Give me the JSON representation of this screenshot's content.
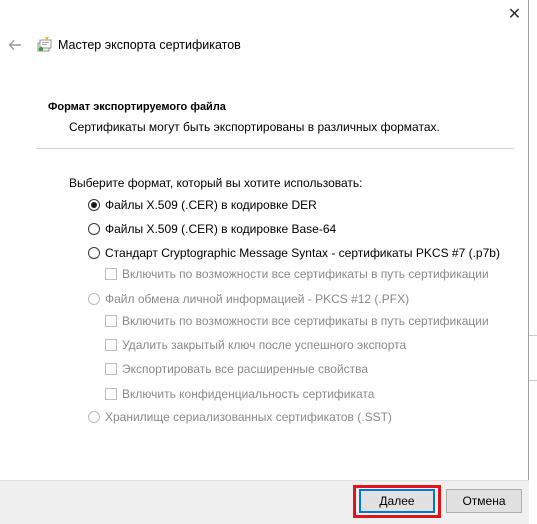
{
  "window": {
    "title": "Мастер экспорта сертификатов",
    "close_glyph": "✕"
  },
  "header": {
    "title": "Формат экспортируемого файла",
    "subtitle": "Сертификаты могут быть экспортированы в различных форматах."
  },
  "prompt": "Выберите формат, который вы хотите использовать:",
  "options": {
    "der": {
      "label": "Файлы X.509 (.CER) в кодировке DER",
      "checked": true,
      "enabled": true
    },
    "base64": {
      "label": "Файлы X.509 (.CER) в кодировке Base-64",
      "checked": false,
      "enabled": true
    },
    "pkcs7": {
      "label": "Стандарт Cryptographic Message Syntax - сертификаты PKCS #7 (.p7b)",
      "checked": false,
      "enabled": true
    },
    "pkcs7_include_chain": {
      "label": "Включить по возможности все сертификаты в путь сертификации",
      "checked": false,
      "enabled": false
    },
    "pfx": {
      "label": "Файл обмена личной информацией - PKCS #12 (.PFX)",
      "checked": false,
      "enabled": false
    },
    "pfx_include_chain": {
      "label": "Включить по возможности все сертификаты в путь сертификации",
      "checked": false,
      "enabled": false
    },
    "pfx_delete_key": {
      "label": "Удалить закрытый ключ после успешного экспорта",
      "checked": false,
      "enabled": false
    },
    "pfx_export_props": {
      "label": "Экспортировать все расширенные свойства",
      "checked": false,
      "enabled": false
    },
    "pfx_privacy": {
      "label": "Включить конфиденциальность сертификата",
      "checked": false,
      "enabled": false
    },
    "sst": {
      "label": "Хранилище сериализованных сертификатов (.SST)",
      "checked": false,
      "enabled": false
    }
  },
  "buttons": {
    "next": "Далее",
    "cancel": "Отмена"
  },
  "colors": {
    "highlight": "#e0141c",
    "default_button_border": "#0078d7",
    "disabled_text": "#8a8a8a"
  }
}
